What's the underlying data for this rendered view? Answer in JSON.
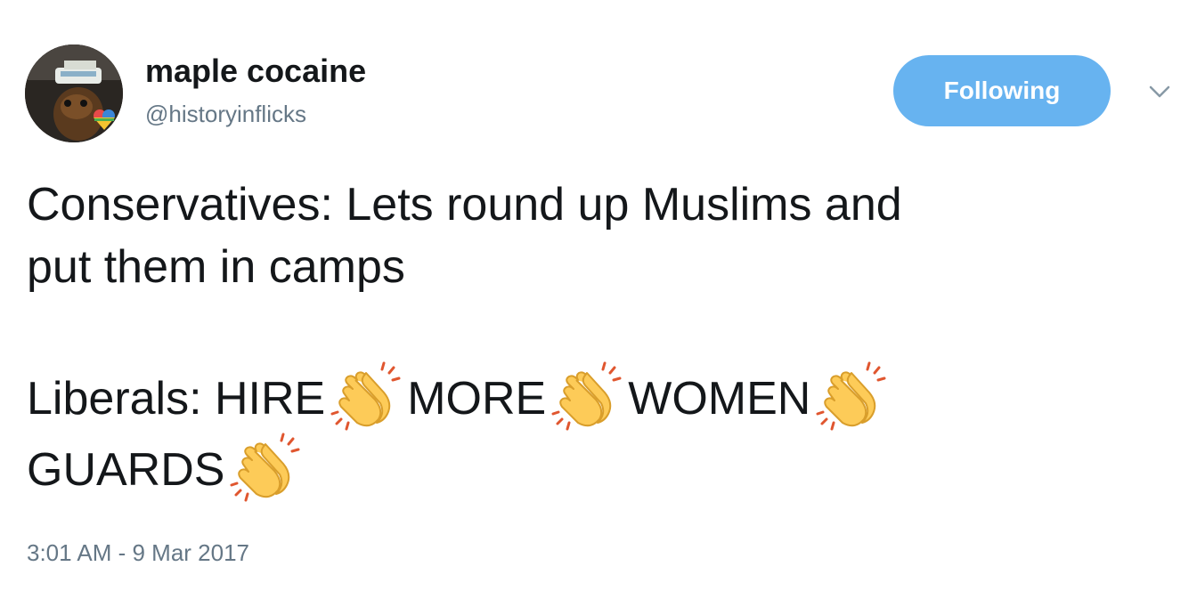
{
  "author": {
    "display_name": "maple cocaine",
    "handle": "@historyinflicks"
  },
  "follow_button": {
    "label": "Following",
    "color": "#67b3f0"
  },
  "menu_caret_icon": "chevron-down-icon",
  "tweet": {
    "line1": "Conservatives: Lets round up Muslims and",
    "line2": "put them in camps",
    "line3_word1": "Liberals: HIRE",
    "line3_word2": "MORE",
    "line3_word3": "WOMEN",
    "line4_word1": "GUARDS",
    "emoji": "clapping-hands-icon"
  },
  "timestamp": "3:01 AM - 9 Mar 2017",
  "colors": {
    "text": "#14171a",
    "secondary": "#657786",
    "accent": "#67b3f0"
  }
}
